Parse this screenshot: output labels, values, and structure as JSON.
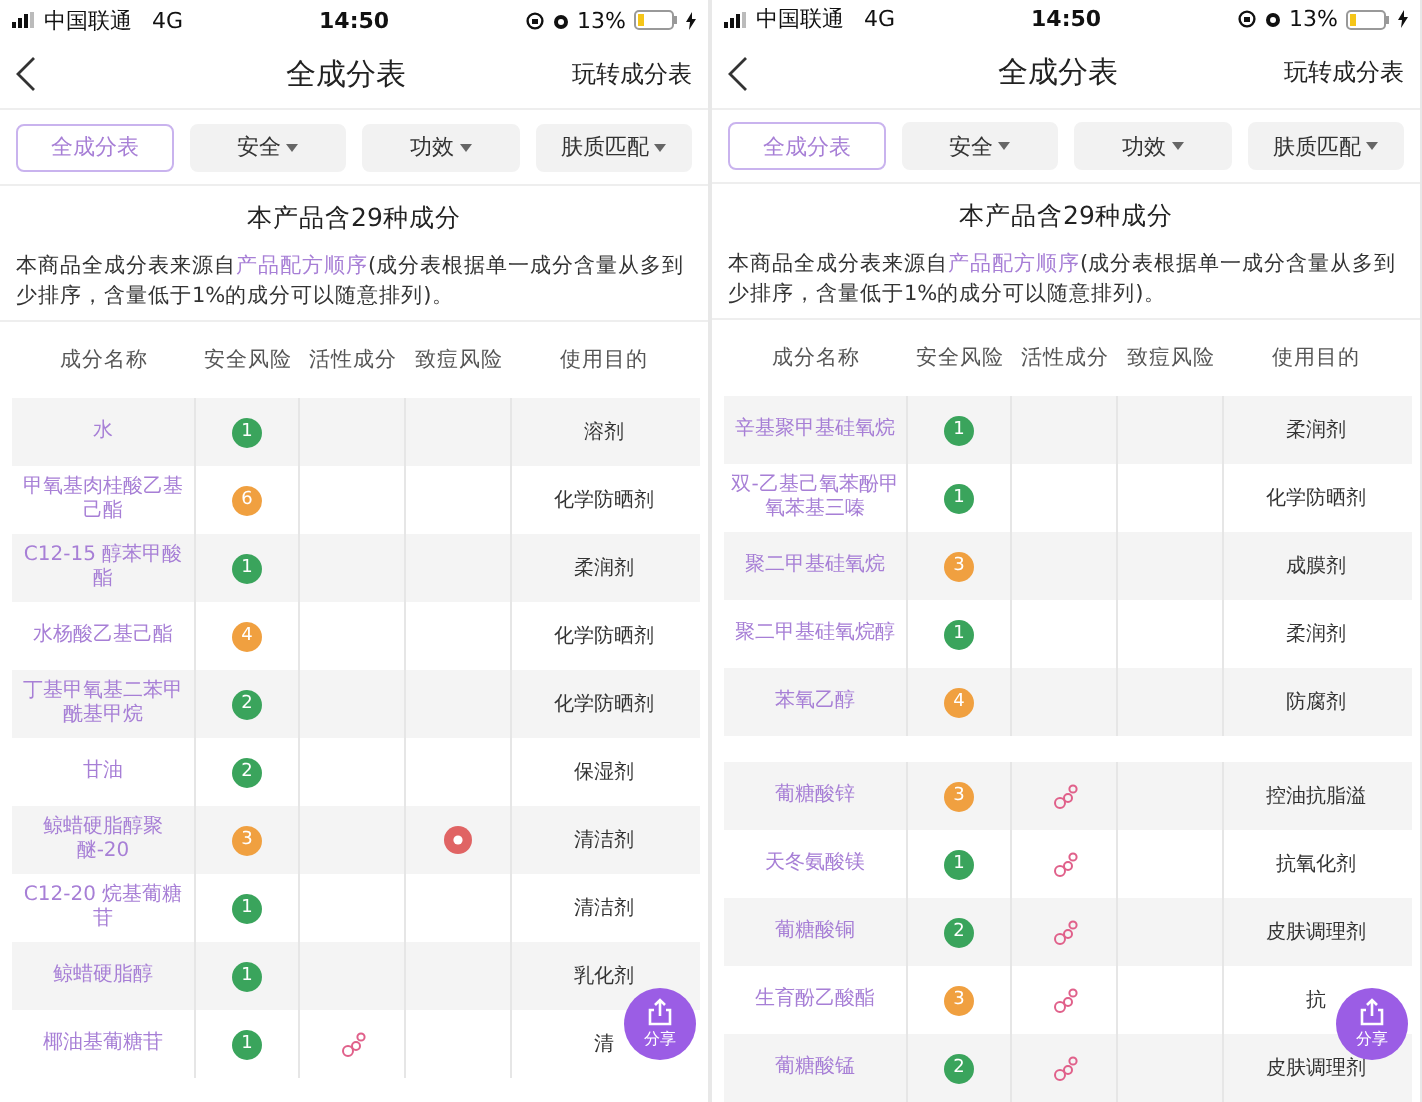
{
  "screens": [
    {
      "status_bar": {
        "carrier": "中国联通",
        "network": "4G",
        "time": "14:50",
        "battery": "13%"
      },
      "nav": {
        "title": "全成分表",
        "action": "玩转成分表"
      },
      "filters": [
        {
          "label": "全成分表",
          "selected": true,
          "dropdown": false
        },
        {
          "label": "安全",
          "selected": false,
          "dropdown": true
        },
        {
          "label": "功效",
          "selected": false,
          "dropdown": true
        },
        {
          "label": "肤质匹配",
          "selected": false,
          "dropdown": true
        }
      ],
      "summary": "本产品含29种成分",
      "description": {
        "text_before": "本商品全成分表来源自",
        "link": "产品配方顺序",
        "text_after": "(成分表根据单一成分含量从多到少排序，含量低于1%的成分可以随意排列)。"
      },
      "columns": [
        "成分名称",
        "安全风险",
        "活性成分",
        "致痘风险",
        "使用目的"
      ],
      "groups": [
        {
          "rows": [
            {
              "name": "水",
              "score": "1",
              "color": "#3aa45c",
              "active": false,
              "acne": false,
              "purpose": "溶剂"
            },
            {
              "name": "甲氧基肉桂酸乙基己酯",
              "score": "6",
              "color": "#f0a040",
              "active": false,
              "acne": false,
              "purpose": "化学防晒剂"
            },
            {
              "name": "C12-15 醇苯甲酸酯",
              "score": "1",
              "color": "#3aa45c",
              "active": false,
              "acne": false,
              "purpose": "柔润剂"
            },
            {
              "name": "水杨酸乙基己酯",
              "score": "4",
              "color": "#f0a040",
              "active": false,
              "acne": false,
              "purpose": "化学防晒剂"
            },
            {
              "name": "丁基甲氧基二苯甲酰基甲烷",
              "score": "2",
              "color": "#3aa45c",
              "active": false,
              "acne": false,
              "purpose": "化学防晒剂"
            },
            {
              "name": "甘油",
              "score": "2",
              "color": "#3aa45c",
              "active": false,
              "acne": false,
              "purpose": "保湿剂"
            },
            {
              "name": "鲸蜡硬脂醇聚醚-20",
              "score": "3",
              "color": "#f0a040",
              "active": false,
              "acne": true,
              "purpose": "清洁剂"
            },
            {
              "name": "C12-20 烷基葡糖苷",
              "score": "1",
              "color": "#3aa45c",
              "active": false,
              "acne": false,
              "purpose": "清洁剂"
            },
            {
              "name": "鲸蜡硬脂醇",
              "score": "1",
              "color": "#3aa45c",
              "active": false,
              "acne": false,
              "purpose": "乳化剂"
            },
            {
              "name": "椰油基葡糖苷",
              "score": "1",
              "color": "#3aa45c",
              "active": true,
              "acne": false,
              "purpose": "清"
            }
          ]
        }
      ],
      "share": "分享"
    },
    {
      "status_bar": {
        "carrier": "中国联通",
        "network": "4G",
        "time": "14:50",
        "battery": "13%"
      },
      "nav": {
        "title": "全成分表",
        "action": "玩转成分表"
      },
      "filters": [
        {
          "label": "全成分表",
          "selected": true,
          "dropdown": false
        },
        {
          "label": "安全",
          "selected": false,
          "dropdown": true
        },
        {
          "label": "功效",
          "selected": false,
          "dropdown": true
        },
        {
          "label": "肤质匹配",
          "selected": false,
          "dropdown": true
        }
      ],
      "summary": "本产品含29种成分",
      "description": {
        "text_before": "本商品全成分表来源自",
        "link": "产品配方顺序",
        "text_after": "(成分表根据单一成分含量从多到少排序，含量低于1%的成分可以随意排列)。"
      },
      "columns": [
        "成分名称",
        "安全风险",
        "活性成分",
        "致痘风险",
        "使用目的"
      ],
      "groups": [
        {
          "rows": [
            {
              "name": "辛基聚甲基硅氧烷",
              "score": "1",
              "color": "#3aa45c",
              "active": false,
              "acne": false,
              "purpose": "柔润剂"
            },
            {
              "name": "双-乙基己氧苯酚甲氧苯基三嗪",
              "score": "1",
              "color": "#3aa45c",
              "active": false,
              "acne": false,
              "purpose": "化学防晒剂"
            },
            {
              "name": "聚二甲基硅氧烷",
              "score": "3",
              "color": "#f0a040",
              "active": false,
              "acne": false,
              "purpose": "成膜剂"
            },
            {
              "name": "聚二甲基硅氧烷醇",
              "score": "1",
              "color": "#3aa45c",
              "active": false,
              "acne": false,
              "purpose": "柔润剂"
            },
            {
              "name": "苯氧乙醇",
              "score": "4",
              "color": "#f0a040",
              "active": false,
              "acne": false,
              "purpose": "防腐剂"
            }
          ]
        },
        {
          "rows": [
            {
              "name": "葡糖酸锌",
              "score": "3",
              "color": "#f0a040",
              "active": true,
              "acne": false,
              "purpose": "控油抗脂溢"
            },
            {
              "name": "天冬氨酸镁",
              "score": "1",
              "color": "#3aa45c",
              "active": true,
              "acne": false,
              "purpose": "抗氧化剂"
            },
            {
              "name": "葡糖酸铜",
              "score": "2",
              "color": "#3aa45c",
              "active": true,
              "acne": false,
              "purpose": "皮肤调理剂"
            },
            {
              "name": "生育酚乙酸酯",
              "score": "3",
              "color": "#f0a040",
              "active": true,
              "acne": false,
              "purpose": "抗"
            },
            {
              "name": "葡糖酸锰",
              "score": "2",
              "color": "#3aa45c",
              "active": true,
              "acne": false,
              "purpose": "皮肤调理剂"
            }
          ]
        }
      ],
      "share": "分享"
    }
  ]
}
